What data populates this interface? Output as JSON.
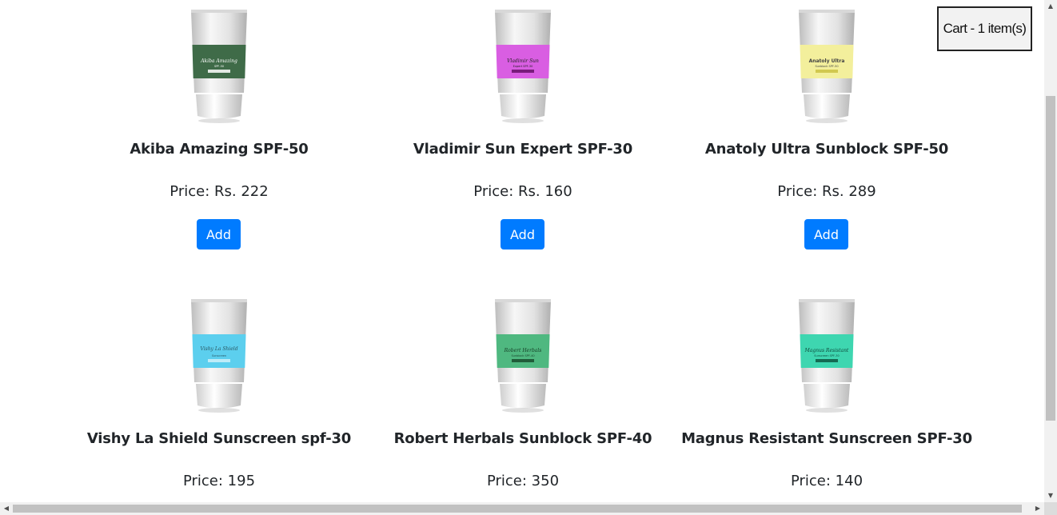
{
  "cart": {
    "label": "Cart - 1 item(s)"
  },
  "product_add_label": "Add",
  "products": [
    {
      "name": "Akiba Amazing SPF-50",
      "price": "Price: Rs. 222",
      "tube_color": "#3f6b48",
      "tube_label": "Akiba Amazing",
      "tube_sub": "SPF-50"
    },
    {
      "name": "Vladimir Sun Expert SPF-30",
      "price": "Price: Rs. 160",
      "tube_color": "#d95ee2",
      "tube_label": "Vladimir Sun",
      "tube_sub": "Expert SPF-30"
    },
    {
      "name": "Anatoly Ultra Sunblock SPF-50",
      "price": "Price: Rs. 289",
      "tube_color": "#f3ef9c",
      "tube_label": "Anatoly Ultra",
      "tube_sub": "Sunblock SPF-50"
    },
    {
      "name": "Vishy La Shield Sunscreen spf-30",
      "price": "Price: 195",
      "tube_color": "#5ccfee",
      "tube_label": "Vishy La Shield",
      "tube_sub": "Sunscreen"
    },
    {
      "name": "Robert Herbals Sunblock SPF-40",
      "price": "Price: 350",
      "tube_color": "#4fb880",
      "tube_label": "Robert Herbals",
      "tube_sub": "Sunblock SPF-40"
    },
    {
      "name": "Magnus Resistant Sunscreen SPF-30",
      "price": "Price: 140",
      "tube_color": "#3ed6b0",
      "tube_label": "Magnus Resistant",
      "tube_sub": "Sunscreen SPF-30"
    }
  ],
  "colors": {
    "button_primary": "#007bff",
    "text": "#212529"
  }
}
